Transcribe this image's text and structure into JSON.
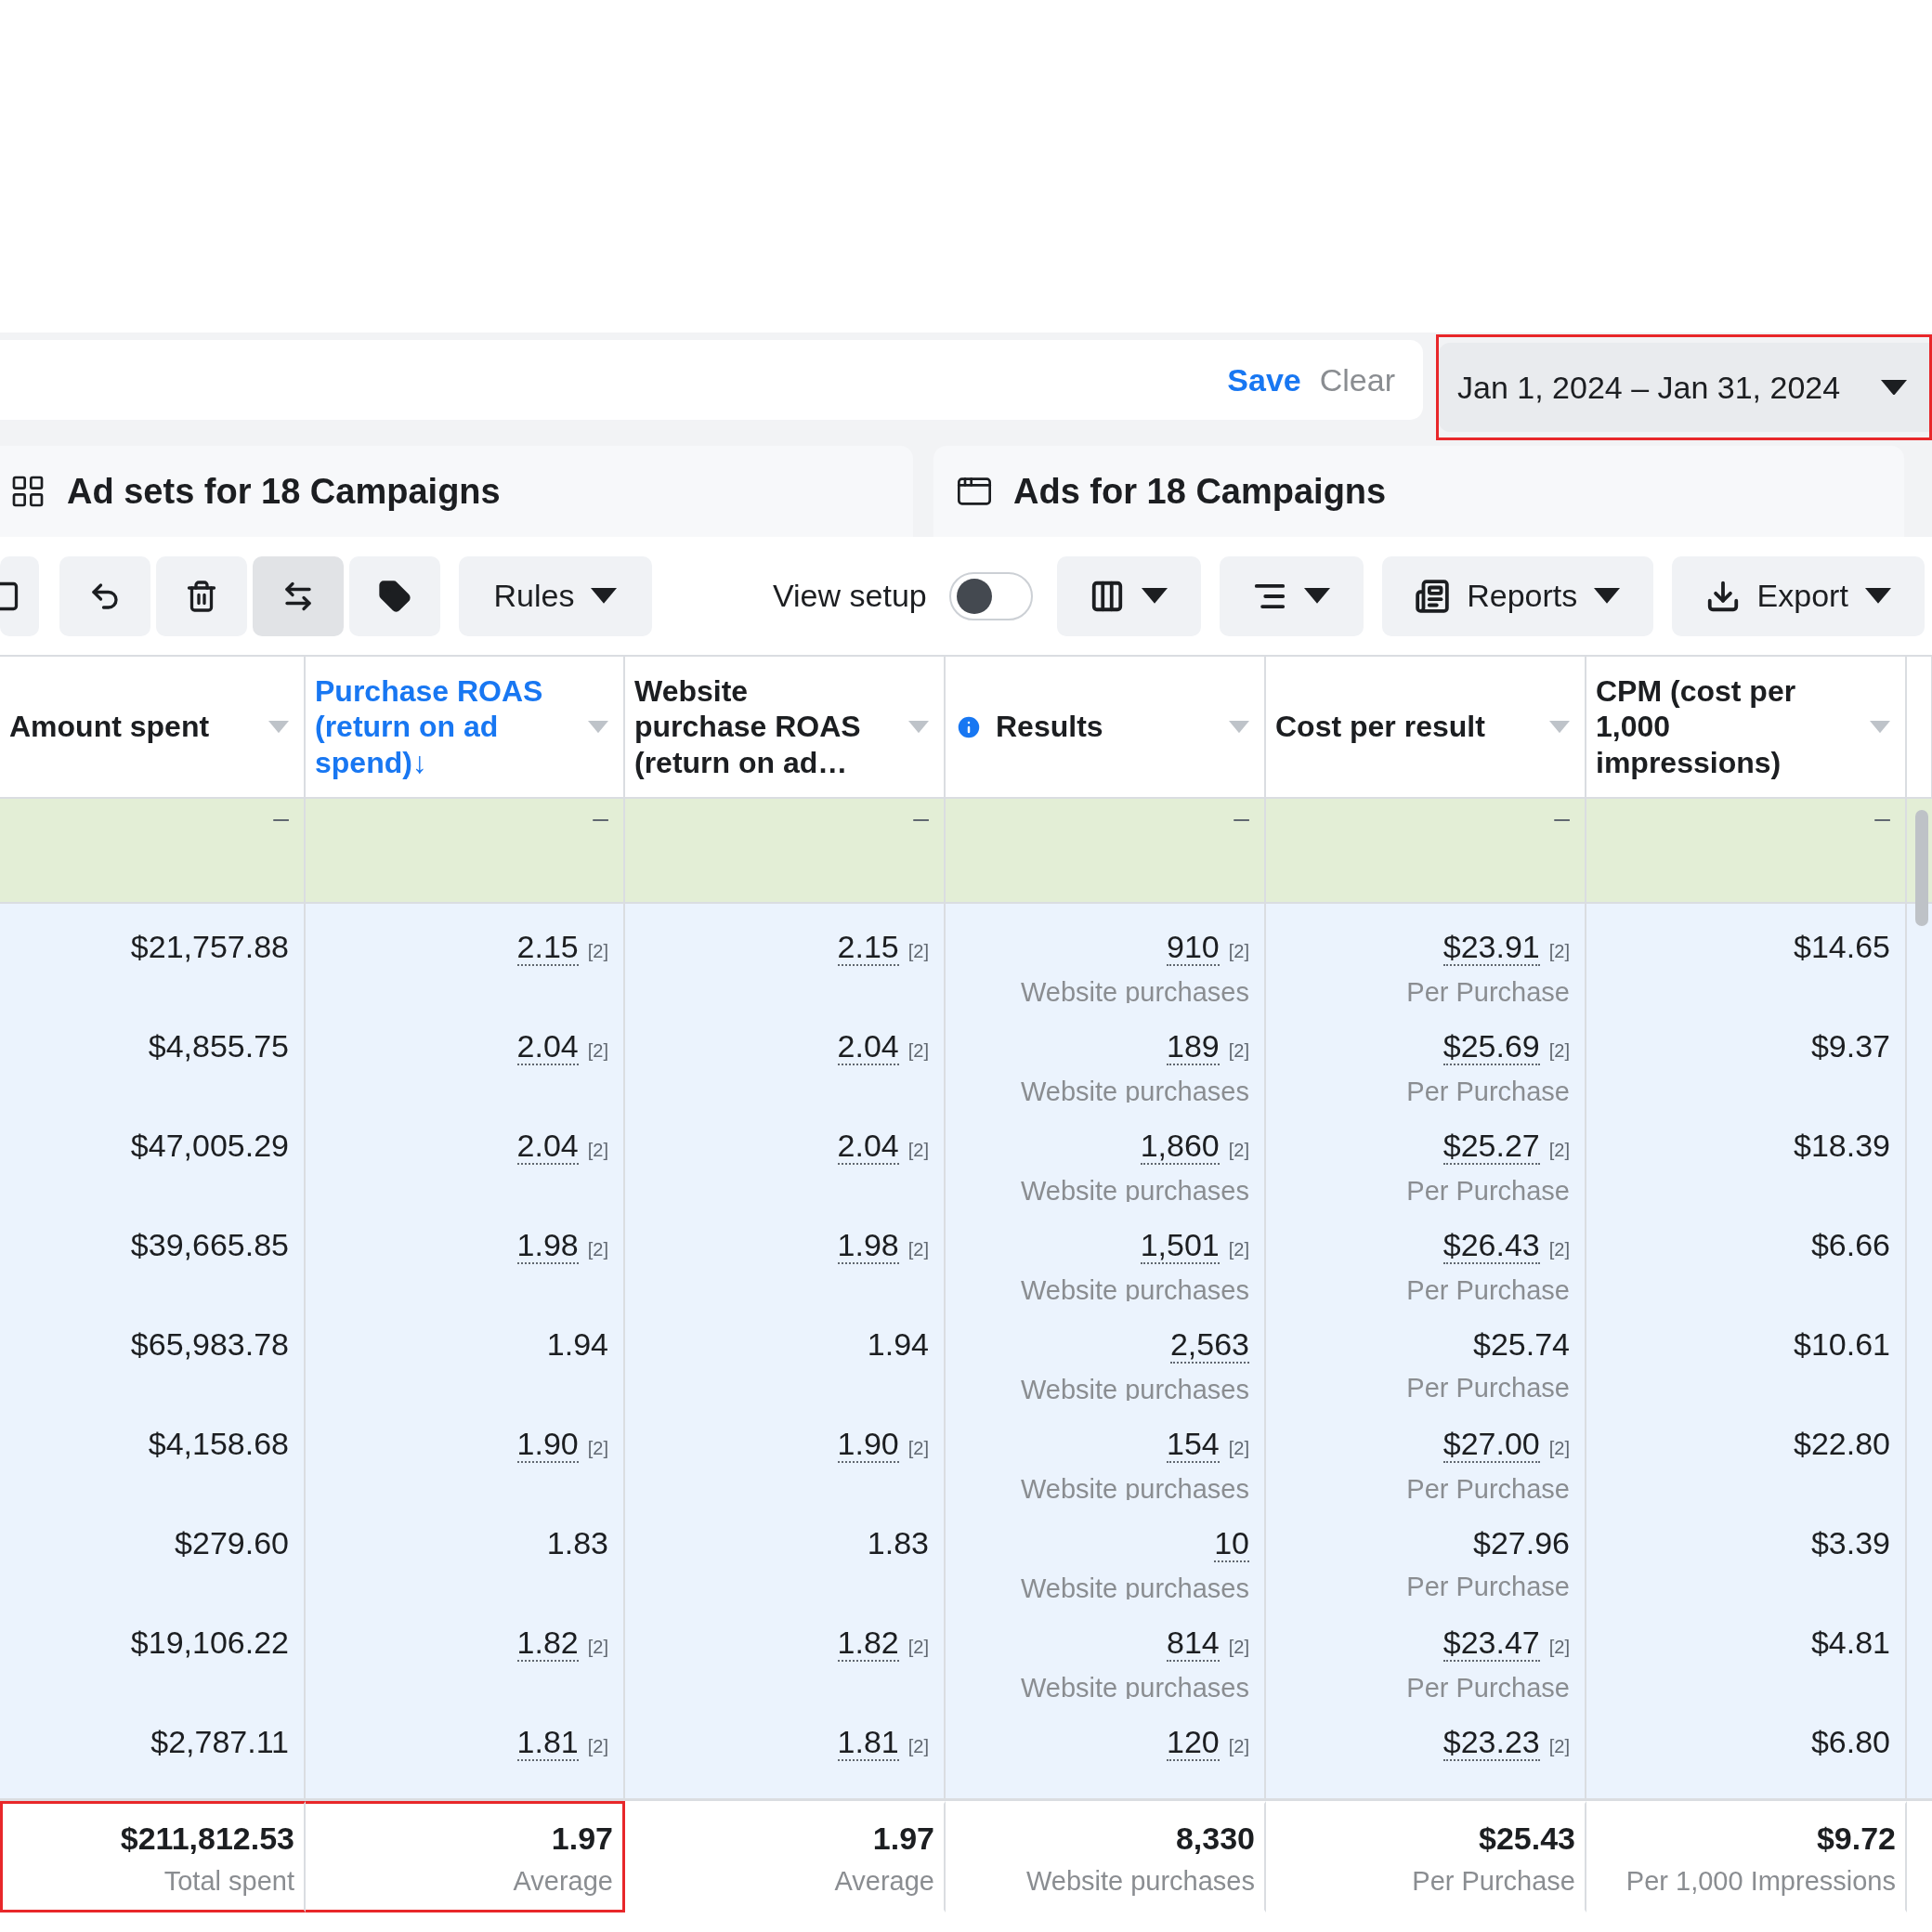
{
  "filter_bar": {
    "save": "Save",
    "clear": "Clear"
  },
  "date_range": {
    "label": "Jan 1, 2024 – Jan 31, 2024",
    "highlighted": true
  },
  "tabs": [
    {
      "label": "Ad sets for 18 Campaigns",
      "kind": "adsets"
    },
    {
      "label": "Ads for 18 Campaigns",
      "kind": "ads"
    }
  ],
  "toolbar": {
    "icon_buttons": [
      {
        "kind": "partial",
        "selected": false
      },
      {
        "kind": "undo",
        "selected": false
      },
      {
        "kind": "delete",
        "selected": false
      },
      {
        "kind": "duplicate",
        "selected": true
      },
      {
        "kind": "tag",
        "selected": false
      }
    ],
    "rules": "Rules",
    "view_setup": {
      "label": "View setup",
      "on": false
    },
    "menus": [
      {
        "kind": "columns"
      },
      {
        "kind": "breakdown"
      },
      {
        "kind": "reports",
        "label": "Reports"
      },
      {
        "kind": "export",
        "label": "Export"
      }
    ]
  },
  "table": {
    "columns": [
      {
        "label": "Amount spent",
        "sorted": false,
        "info": false
      },
      {
        "label": "Purchase ROAS (return on ad spend)",
        "sorted": true,
        "sort_arrow": "↓",
        "info": false
      },
      {
        "label": "Website purchase ROAS (return on ad…",
        "sorted": false,
        "info": false
      },
      {
        "label": "Results",
        "sorted": false,
        "info": true
      },
      {
        "label": "Cost per result",
        "sorted": false,
        "info": false
      },
      {
        "label": "CPM (cost per 1,000 impressions)",
        "sorted": false,
        "info": false
      }
    ],
    "summary_row": [
      "–",
      "–",
      "–",
      "–",
      "–",
      "–"
    ],
    "rows": [
      [
        {
          "value": "$21,757.88"
        },
        {
          "value": "2.15",
          "note": "[2]",
          "underlined": true
        },
        {
          "value": "2.15",
          "note": "[2]",
          "underlined": true
        },
        {
          "value": "910",
          "note": "[2]",
          "underlined": true,
          "sub": "Website purchases"
        },
        {
          "value": "$23.91",
          "note": "[2]",
          "underlined": true,
          "sub": "Per Purchase"
        },
        {
          "value": "$14.65"
        }
      ],
      [
        {
          "value": "$4,855.75"
        },
        {
          "value": "2.04",
          "note": "[2]",
          "underlined": true
        },
        {
          "value": "2.04",
          "note": "[2]",
          "underlined": true
        },
        {
          "value": "189",
          "note": "[2]",
          "underlined": true,
          "sub": "Website purchases"
        },
        {
          "value": "$25.69",
          "note": "[2]",
          "underlined": true,
          "sub": "Per Purchase"
        },
        {
          "value": "$9.37"
        }
      ],
      [
        {
          "value": "$47,005.29"
        },
        {
          "value": "2.04",
          "note": "[2]",
          "underlined": true
        },
        {
          "value": "2.04",
          "note": "[2]",
          "underlined": true
        },
        {
          "value": "1,860",
          "note": "[2]",
          "underlined": true,
          "sub": "Website purchases"
        },
        {
          "value": "$25.27",
          "note": "[2]",
          "underlined": true,
          "sub": "Per Purchase"
        },
        {
          "value": "$18.39"
        }
      ],
      [
        {
          "value": "$39,665.85"
        },
        {
          "value": "1.98",
          "note": "[2]",
          "underlined": true
        },
        {
          "value": "1.98",
          "note": "[2]",
          "underlined": true
        },
        {
          "value": "1,501",
          "note": "[2]",
          "underlined": true,
          "sub": "Website purchases"
        },
        {
          "value": "$26.43",
          "note": "[2]",
          "underlined": true,
          "sub": "Per Purchase"
        },
        {
          "value": "$6.66"
        }
      ],
      [
        {
          "value": "$65,983.78"
        },
        {
          "value": "1.94",
          "underlined": false
        },
        {
          "value": "1.94",
          "underlined": false
        },
        {
          "value": "2,563",
          "underlined": true,
          "sub": "Website purchases"
        },
        {
          "value": "$25.74",
          "underlined": false,
          "sub": "Per Purchase"
        },
        {
          "value": "$10.61"
        }
      ],
      [
        {
          "value": "$4,158.68"
        },
        {
          "value": "1.90",
          "note": "[2]",
          "underlined": true
        },
        {
          "value": "1.90",
          "note": "[2]",
          "underlined": true
        },
        {
          "value": "154",
          "note": "[2]",
          "underlined": true,
          "sub": "Website purchases"
        },
        {
          "value": "$27.00",
          "note": "[2]",
          "underlined": true,
          "sub": "Per Purchase"
        },
        {
          "value": "$22.80"
        }
      ],
      [
        {
          "value": "$279.60"
        },
        {
          "value": "1.83",
          "underlined": false
        },
        {
          "value": "1.83",
          "underlined": false
        },
        {
          "value": "10",
          "underlined": true,
          "sub": "Website purchases"
        },
        {
          "value": "$27.96",
          "underlined": false,
          "sub": "Per Purchase"
        },
        {
          "value": "$3.39"
        }
      ],
      [
        {
          "value": "$19,106.22"
        },
        {
          "value": "1.82",
          "note": "[2]",
          "underlined": true
        },
        {
          "value": "1.82",
          "note": "[2]",
          "underlined": true
        },
        {
          "value": "814",
          "note": "[2]",
          "underlined": true,
          "sub": "Website purchases"
        },
        {
          "value": "$23.47",
          "note": "[2]",
          "underlined": true,
          "sub": "Per Purchase"
        },
        {
          "value": "$4.81"
        }
      ],
      [
        {
          "value": "$2,787.11"
        },
        {
          "value": "1.81",
          "note": "[2]",
          "underlined": true
        },
        {
          "value": "1.81",
          "note": "[2]",
          "underlined": true
        },
        {
          "value": "120",
          "note": "[2]",
          "underlined": true
        },
        {
          "value": "$23.23",
          "note": "[2]",
          "underlined": true
        },
        {
          "value": "$6.80"
        }
      ]
    ],
    "totals": [
      {
        "value": "$211,812.53",
        "label": "Total spent",
        "highlighted": true
      },
      {
        "value": "1.97",
        "label": "Average",
        "highlighted": true
      },
      {
        "value": "1.97",
        "label": "Average",
        "highlighted": false
      },
      {
        "value": "8,330",
        "label": "Website purchases",
        "highlighted": false
      },
      {
        "value": "$25.43",
        "label": "Per Purchase",
        "highlighted": false
      },
      {
        "value": "$9.72",
        "label": "Per 1,000 Impressions",
        "highlighted": false
      }
    ]
  }
}
